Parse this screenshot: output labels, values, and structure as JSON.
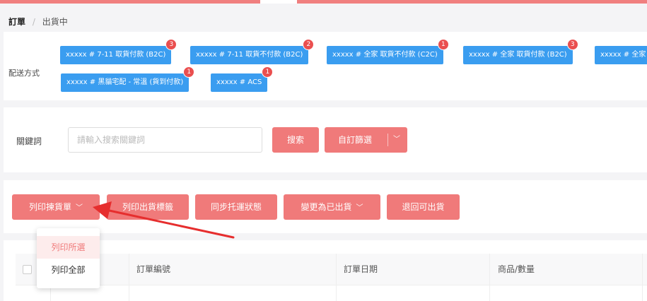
{
  "breadcrumb": {
    "root": "訂單",
    "separator": "/",
    "current": "出貨中"
  },
  "shipping": {
    "label": "配送方式",
    "chips": [
      {
        "text": "xxxxx # 7-11 取貨付款 (B2C)",
        "badge": "3"
      },
      {
        "text": "xxxxx # 7-11 取貨不付款 (B2C)",
        "badge": "2"
      },
      {
        "text": "xxxxx # 全家 取貨不付款 (C2C)",
        "badge": "1"
      },
      {
        "text": "xxxxx # 全家 取貨付款 (B2C)",
        "badge": "3"
      },
      {
        "text": "xxxxx # 全家 I",
        "badge": ""
      },
      {
        "text": "xxxxx # 黑貓宅配 - 常溫 (貨到付款)",
        "badge": "1"
      },
      {
        "text": "xxxxx # ACS",
        "badge": "1"
      }
    ]
  },
  "search": {
    "label": "關鍵詞",
    "placeholder": "請輸入搜索關鍵詞",
    "search_button": "搜索",
    "custom_filter_button": "自訂篩選"
  },
  "actions": {
    "print_picklist": "列印揀貨單",
    "print_label": "列印出貨標籤",
    "sync_status": "同步托運狀態",
    "mark_shipped": "變更為已出貨",
    "return_shippable": "退回可出貨"
  },
  "dropdown": {
    "items": [
      "列印所選",
      "列印全部"
    ]
  },
  "table": {
    "columns": [
      "訂單編號",
      "訂單日期",
      "商品/數量"
    ]
  },
  "colors": {
    "accent": "#f07a7a",
    "chip": "#3a9df0",
    "badge": "#ea4f4f",
    "arrow": "#e62e2e"
  },
  "icons": {
    "dropdown": "chevron-down-icon"
  }
}
